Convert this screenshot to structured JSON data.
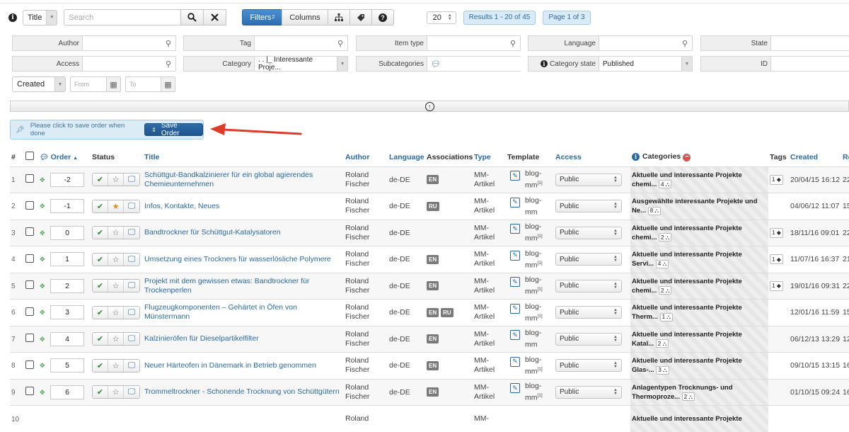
{
  "toolbar": {
    "search_field_select": "Title",
    "search_placeholder": "Search",
    "filters_label": "Filters",
    "filters_count": "2",
    "columns_label": "Columns",
    "limit_value": "20",
    "results_badge": "Results 1 - 20 of 45",
    "page_badge": "Page 1 of 3"
  },
  "filters": {
    "author_label": "Author",
    "tag_label": "Tag",
    "item_type_label": "Item type",
    "language_label": "Language",
    "state_label": "State",
    "access_label": "Access",
    "category_label": "Category",
    "category_value": ". . |_ Interessante Proje...",
    "subcategories_label": "Subcategories",
    "category_state_label": "Category state",
    "category_state_value": "Published",
    "id_label": "ID",
    "date_field_value": "Created",
    "from_placeholder": "From",
    "to_placeholder": "To"
  },
  "notice": {
    "text": "Please click to save order when done",
    "save_order_label": "Save Order"
  },
  "table": {
    "headers": {
      "num": "#",
      "order": "Order",
      "status": "Status",
      "title": "Title",
      "author": "Author",
      "language": "Language",
      "associations": "Associations",
      "type": "Type",
      "template": "Template",
      "access": "Access",
      "categories": "Categories",
      "tags": "Tags",
      "created": "Created",
      "extra": "Re"
    },
    "rows": [
      {
        "num": "1",
        "order": "-2",
        "featured": false,
        "title": "Schüttgut-Bandkalzinierer für ein global agierendes Chemieunternehmen",
        "author1": "Roland",
        "author2": "Fischer",
        "lang": "de-DE",
        "assoc": [
          "EN"
        ],
        "type1": "MM-",
        "type2": "Artikel",
        "tpl1": "blog-",
        "tpl2": "mm",
        "tpl_sup": "[1]",
        "access": "Public",
        "cat1": "Aktuelle und interessante Projekte",
        "cat2": "chemi...",
        "catcount": "4",
        "tags": "1",
        "created": "20/04/15 16:12",
        "extra": "22."
      },
      {
        "num": "2",
        "order": "-1",
        "featured": true,
        "title": "Infos, Kontakte, Neues",
        "author1": "Roland",
        "author2": "Fischer",
        "lang": "de-DE",
        "assoc": [
          "RU"
        ],
        "type1": "MM-",
        "type2": "Artikel",
        "tpl1": "blog-",
        "tpl2": "mm",
        "tpl_sup": "",
        "access": "Public",
        "cat1": "Ausgewählte interessante Projekte und",
        "cat2": "Ne...",
        "catcount": "8",
        "tags": "",
        "created": "04/06/12 11:07",
        "extra": "15."
      },
      {
        "num": "3",
        "order": "0",
        "featured": false,
        "title": "Bandtrockner für Schüttgut-Katalysatoren",
        "author1": "Roland",
        "author2": "Fischer",
        "lang": "de-DE",
        "assoc": [],
        "type1": "MM-",
        "type2": "Artikel",
        "tpl1": "blog-",
        "tpl2": "mm",
        "tpl_sup": "[1]",
        "access": "Public",
        "cat1": "Aktuelle und interessante Projekte",
        "cat2": "chemi...",
        "catcount": "2",
        "tags": "1",
        "created": "18/11/16 09:01",
        "extra": "22."
      },
      {
        "num": "4",
        "order": "1",
        "featured": false,
        "title": "Umsetzung eines Trockners für wasserlösliche Polymere",
        "author1": "Roland",
        "author2": "Fischer",
        "lang": "de-DE",
        "assoc": [
          "EN"
        ],
        "type1": "MM-",
        "type2": "Artikel",
        "tpl1": "blog-",
        "tpl2": "mm",
        "tpl_sup": "[1]",
        "access": "Public",
        "cat1": "Aktuelle und interessante Projekte",
        "cat2": "Servi...",
        "catcount": "4",
        "tags": "1",
        "created": "11/07/16 16:37",
        "extra": "21."
      },
      {
        "num": "5",
        "order": "2",
        "featured": false,
        "title": "Projekt mit dem gewissen etwas: Bandtrockner für Trockenperlen",
        "author1": "Roland",
        "author2": "Fischer",
        "lang": "de-DE",
        "assoc": [
          "EN"
        ],
        "type1": "MM-",
        "type2": "Artikel",
        "tpl1": "blog-",
        "tpl2": "mm",
        "tpl_sup": "[1]",
        "access": "Public",
        "cat1": "Aktuelle und interessante Projekte",
        "cat2": "chemi...",
        "catcount": "2",
        "tags": "1",
        "created": "19/01/16 09:31",
        "extra": "22."
      },
      {
        "num": "6",
        "order": "3",
        "featured": false,
        "title": "Flugzeugkomponenten – Gehärtet in Öfen von Münstermann",
        "author1": "Roland",
        "author2": "Fischer",
        "lang": "de-DE",
        "assoc": [
          "EN",
          "RU"
        ],
        "type1": "MM-",
        "type2": "Artikel",
        "tpl1": "blog-",
        "tpl2": "mm",
        "tpl_sup": "[1]",
        "access": "Public",
        "cat1": "Aktuelle und interessante Projekte",
        "cat2": "Therm...",
        "catcount": "1",
        "tags": "",
        "created": "12/01/16 11:59",
        "extra": "15."
      },
      {
        "num": "7",
        "order": "4",
        "featured": false,
        "title": "Kalzinieröfen für Dieselpartikelfilter",
        "author1": "Roland",
        "author2": "Fischer",
        "lang": "de-DE",
        "assoc": [
          "EN"
        ],
        "type1": "MM-",
        "type2": "Artikel",
        "tpl1": "blog-",
        "tpl2": "mm",
        "tpl_sup": "",
        "access": "Public",
        "cat1": "Aktuelle und interessante Projekte",
        "cat2": "Katal...",
        "catcount": "2",
        "tags": "",
        "created": "06/12/13 13:29",
        "extra": "12."
      },
      {
        "num": "8",
        "order": "5",
        "featured": false,
        "title": "Neuer Härteofen in Dänemark in Betrieb genommen",
        "author1": "Roland",
        "author2": "Fischer",
        "lang": "de-DE",
        "assoc": [
          "EN"
        ],
        "type1": "MM-",
        "type2": "Artikel",
        "tpl1": "blog-",
        "tpl2": "mm",
        "tpl_sup": "[1]",
        "access": "Public",
        "cat1": "Aktuelle und interessante Projekte",
        "cat2": "Glas-...",
        "catcount": "3",
        "tags": "",
        "created": "09/10/15 13:15",
        "extra": "16."
      },
      {
        "num": "9",
        "order": "6",
        "featured": false,
        "title": "Trommeltrockner - Schonende Trocknung von Schüttgütern",
        "author1": "Roland",
        "author2": "Fischer",
        "lang": "de-DE",
        "assoc": [
          "EN"
        ],
        "type1": "MM-",
        "type2": "Artikel",
        "tpl1": "blog-",
        "tpl2": "mm",
        "tpl_sup": "[1]",
        "access": "Public",
        "cat1": "Anlagentypen Trocknungs- und",
        "cat2": "Thermoproze...",
        "catcount": "2",
        "tags": "",
        "created": "01/10/15 09:24",
        "extra": "16."
      },
      {
        "num": "10",
        "order": "",
        "featured": false,
        "title": "",
        "author1": "Roland",
        "author2": "",
        "lang": "",
        "assoc": [],
        "type1": "MM-",
        "type2": "",
        "tpl1": "",
        "tpl2": "",
        "tpl_sup": "",
        "access": "",
        "cat1": "Aktuelle und interessante Projekte",
        "cat2": "",
        "catcount": "",
        "tags": "",
        "created": "",
        "extra": ""
      }
    ]
  }
}
